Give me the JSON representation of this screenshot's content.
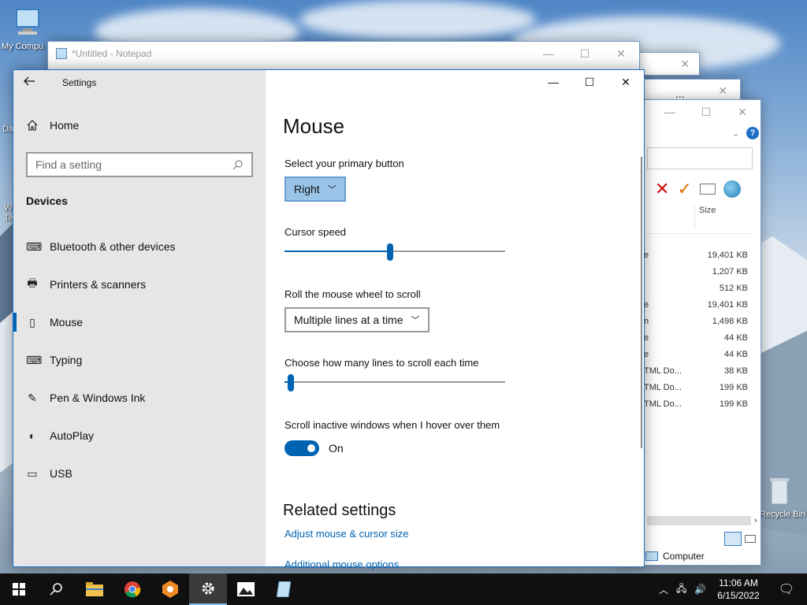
{
  "desktop": {
    "icons": [
      {
        "label": "My Compu",
        "icon": "computer-icon"
      },
      {
        "label": "Recycle Bin",
        "icon": "recycle-bin-icon"
      }
    ],
    "left_edge_labels": [
      "Da",
      "W",
      "Te"
    ]
  },
  "notepad": {
    "title": "*Untitled - Notepad"
  },
  "explorer": {
    "column_header": "Size",
    "type_fragments": [
      "e",
      "",
      "",
      "e",
      "n",
      "e",
      "e",
      "TML Do...",
      "TML Do...",
      "TML Do..."
    ],
    "sizes": [
      "19,401 KB",
      "1,207 KB",
      "512 KB",
      "19,401 KB",
      "1,498 KB",
      "44 KB",
      "44 KB",
      "38 KB",
      "199 KB",
      "199 KB"
    ],
    "status_location": "Computer",
    "help_glyph": "?",
    "ellipsis": "..."
  },
  "settings": {
    "window_title": "Settings",
    "home_label": "Home",
    "search_placeholder": "Find a setting",
    "section_heading": "Devices",
    "nav_items": [
      {
        "label": "Bluetooth & other devices",
        "icon": "bluetooth-devices-icon"
      },
      {
        "label": "Printers & scanners",
        "icon": "printer-icon"
      },
      {
        "label": "Mouse",
        "icon": "mouse-icon",
        "selected": true
      },
      {
        "label": "Typing",
        "icon": "keyboard-icon"
      },
      {
        "label": "Pen & Windows Ink",
        "icon": "pen-icon"
      },
      {
        "label": "AutoPlay",
        "icon": "autoplay-icon"
      },
      {
        "label": "USB",
        "icon": "usb-icon"
      }
    ],
    "page_title": "Mouse",
    "primary_button": {
      "label": "Select your primary button",
      "value": "Right"
    },
    "cursor_speed": {
      "label": "Cursor speed",
      "value_fraction": 0.48
    },
    "wheel_scroll": {
      "label": "Roll the mouse wheel to scroll",
      "value": "Multiple lines at a time"
    },
    "lines_scroll": {
      "label": "Choose how many lines to scroll each time",
      "value_fraction": 0.03
    },
    "inactive_scroll": {
      "label": "Scroll inactive windows when I hover over them",
      "state": "On"
    },
    "related_heading": "Related settings",
    "links": [
      "Adjust mouse & cursor size",
      "Additional mouse options"
    ],
    "accent_color": "#0063b1"
  },
  "taskbar": {
    "time": "11:06 AM",
    "date": "6/15/2022"
  }
}
